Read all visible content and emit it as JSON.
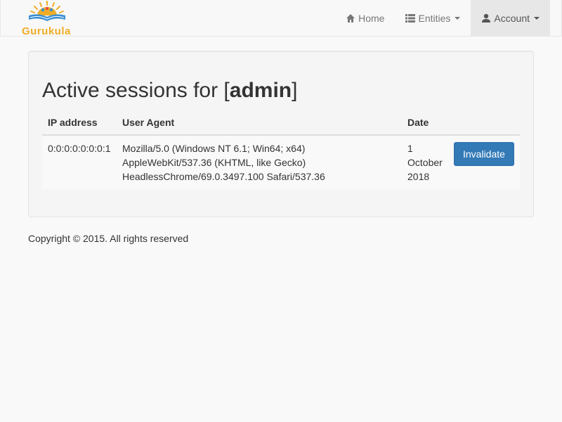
{
  "brand": {
    "name": "Gurukula",
    "logo_icon": "gurukula-logo-icon"
  },
  "nav": {
    "home": {
      "label": "Home",
      "icon": "home-icon"
    },
    "entities": {
      "label": "Entities",
      "icon": "list-icon"
    },
    "account": {
      "label": "Account",
      "icon": "user-icon"
    }
  },
  "page": {
    "title_prefix": "Active sessions for [",
    "title_user": "admin",
    "title_suffix": "]"
  },
  "table": {
    "headers": {
      "ip": "IP address",
      "agent": "User Agent",
      "date": "Date"
    },
    "rows": [
      {
        "ip": "0:0:0:0:0:0:0:1",
        "agent_line1": "Mozilla/5.0 (Windows NT 6.1; Win64; x64)",
        "agent_line2": "AppleWebKit/537.36 (KHTML, like Gecko)",
        "agent_line3": "HeadlessChrome/69.0.3497.100 Safari/537.36",
        "date_line1": "1",
        "date_line2": "October",
        "date_line3": "2018",
        "action_label": "Invalidate"
      }
    ]
  },
  "footer": {
    "text": "Copyright © 2015. All rights reserved"
  },
  "colors": {
    "brand": "#f0ad28",
    "primary": "#337ab7"
  }
}
